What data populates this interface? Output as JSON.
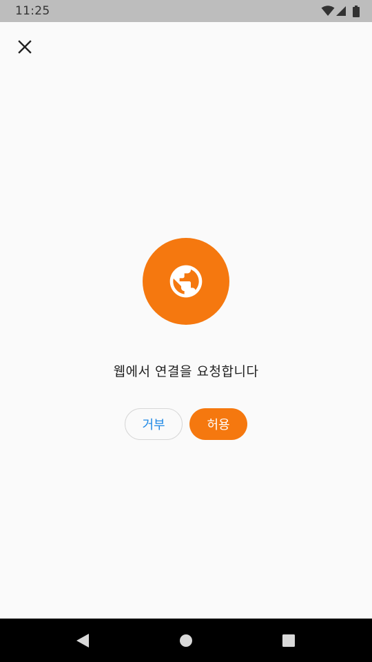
{
  "status_bar": {
    "time": "11:25",
    "icons": [
      "wifi-icon",
      "signal-icon",
      "battery-icon"
    ]
  },
  "toolbar": {
    "close_icon": "close-icon"
  },
  "dialog": {
    "icon": "globe-icon",
    "message": "웹에서 연결을 요청합니다",
    "deny_label": "거부",
    "allow_label": "허용"
  },
  "nav_bar": {
    "icons": [
      "back-icon",
      "home-icon",
      "recents-icon"
    ]
  },
  "colors": {
    "accent": "#f5780f",
    "deny_text": "#1e88e5",
    "background": "#fafafa",
    "status_bar": "#bdbdbd",
    "nav_bar": "#000000"
  }
}
